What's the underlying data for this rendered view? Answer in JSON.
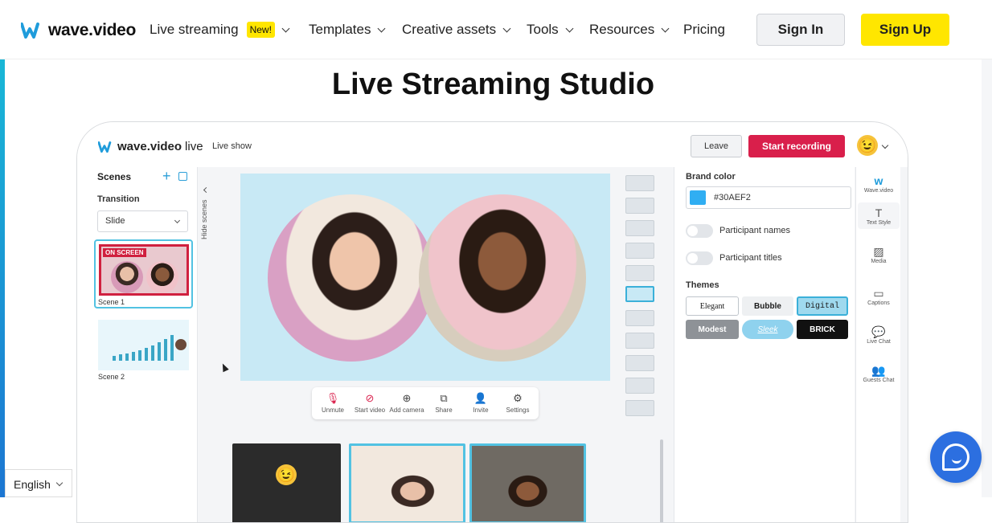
{
  "nav": {
    "logo_text": "wave.video",
    "items": [
      {
        "label": "Live streaming",
        "badge": "New!"
      },
      {
        "label": "Templates"
      },
      {
        "label": "Creative assets"
      },
      {
        "label": "Tools"
      },
      {
        "label": "Resources"
      },
      {
        "label": "Pricing"
      }
    ],
    "sign_in": "Sign In",
    "sign_up": "Sign Up"
  },
  "hero": {
    "title": "Live Streaming Studio"
  },
  "studio": {
    "logo_text": "wave.video",
    "logo_suffix": "live",
    "show_label": "Live show",
    "leave": "Leave",
    "start_recording": "Start recording",
    "scenes": {
      "heading": "Scenes",
      "transition_label": "Transition",
      "transition_value": "Slide",
      "hide_label": "Hide scenes",
      "on_screen": "ON SCREEN",
      "scene1": "Scene 1",
      "scene2": "Scene 2"
    },
    "controls": [
      {
        "label": "Unmute",
        "icon": "mic-off-icon"
      },
      {
        "label": "Start video",
        "icon": "camera-off-icon"
      },
      {
        "label": "Add camera",
        "icon": "plus-circle-icon"
      },
      {
        "label": "Share",
        "icon": "share-screen-icon"
      },
      {
        "label": "Invite",
        "icon": "invite-icon"
      },
      {
        "label": "Settings",
        "icon": "gear-icon"
      }
    ],
    "right_panel": {
      "brand_color_label": "Brand color",
      "brand_color_value": "#30AEF2",
      "participant_names": "Participant names",
      "participant_titles": "Participant titles",
      "themes_label": "Themes",
      "themes": [
        "Elegant",
        "Bubble",
        "Digital",
        "Modest",
        "Sleek",
        "BRICK"
      ]
    },
    "icon_column": [
      {
        "label": "Wave.video",
        "icon": "wave-logo-icon"
      },
      {
        "label": "Text Style",
        "icon": "text-icon"
      },
      {
        "label": "Media",
        "icon": "image-icon"
      },
      {
        "label": "Captions",
        "icon": "captions-icon"
      },
      {
        "label": "Live Chat",
        "icon": "chat-icon"
      },
      {
        "label": "Guests Chat",
        "icon": "guests-icon"
      }
    ]
  },
  "footer": {
    "language": "English"
  },
  "colors": {
    "accent": "#ffe600",
    "record": "#d91f4b",
    "brand": "#30AEF2"
  }
}
